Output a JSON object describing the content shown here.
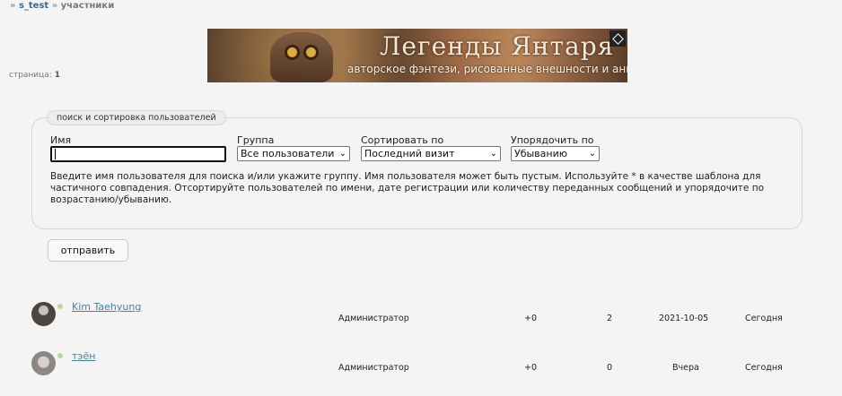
{
  "breadcrumbs": {
    "sep": "»",
    "forum": "s_test",
    "current": "участники"
  },
  "banner": {
    "title": "Легенды Янтаря",
    "subtitle": "авторское фэнтези, рисованные внешности и аниме"
  },
  "pagination": {
    "label": "страница:",
    "current": "1"
  },
  "search_form": {
    "legend": "поиск и сортировка пользователей",
    "name_label": "Имя",
    "name_value": "",
    "group_label": "Группа",
    "group_value": "Все пользователи",
    "sort_label": "Сортировать по",
    "sort_value": "Последний визит",
    "order_label": "Упорядочить по",
    "order_value": "Убыванию",
    "help": "Введите имя пользователя для поиска и/или укажите группу. Имя пользователя может быть пустым. Используйте * в качестве шаблона для частичного совпадения. Отсортируйте пользователей по имени, дате регистрации или количеству переданных сообщений и упорядочите по возрастанию/убыванию.",
    "submit_label": "отправить"
  },
  "users": [
    {
      "name": "Kim Taehyung",
      "group": "Администратор",
      "respect": "+0",
      "posts": "2",
      "registered": "2021-10-05",
      "last_visit": "Сегодня"
    },
    {
      "name": "тэён",
      "group": "Администратор",
      "respect": "+0",
      "posts": "0",
      "registered": "Вчера",
      "last_visit": "Сегодня"
    }
  ],
  "colors": {
    "link": "#4a7fa0",
    "online": "#b9d8a6",
    "background": "#f4f4f4"
  }
}
